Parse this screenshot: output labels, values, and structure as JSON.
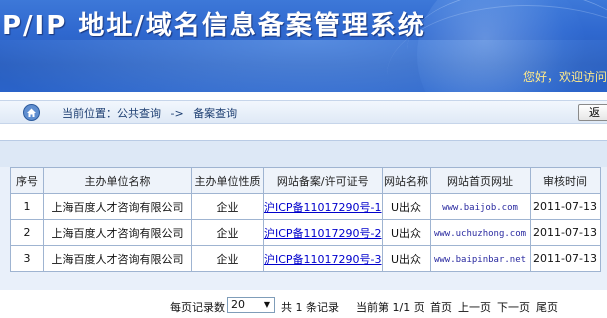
{
  "banner": {
    "title": "P/IP 地址/域名信息备案管理系统",
    "greeting": "您好，欢迎访问"
  },
  "breadcrumb": {
    "prefix": "当前位置：公共查询",
    "separator": "->",
    "current": "备案查询",
    "button_label": "返"
  },
  "table": {
    "headers": [
      "序号",
      "主办单位名称",
      "主办单位性质",
      "网站备案/许可证号",
      "网站名称",
      "网站首页网址",
      "审核时间"
    ],
    "rows": [
      {
        "no": "1",
        "org": "上海百度人才咨询有限公司",
        "type": "企业",
        "permit": "沪ICP备11017290号-1",
        "site": "U出众",
        "url": "www.baijob.com",
        "date": "2011-07-13"
      },
      {
        "no": "2",
        "org": "上海百度人才咨询有限公司",
        "type": "企业",
        "permit": "沪ICP备11017290号-2",
        "site": "U出众",
        "url": "www.uchuzhong.com",
        "date": "2011-07-13"
      },
      {
        "no": "3",
        "org": "上海百度人才咨询有限公司",
        "type": "企业",
        "permit": "沪ICP备11017290号-3",
        "site": "U出众",
        "url": "www.baipinbar.net",
        "date": "2011-07-13"
      }
    ]
  },
  "pager": {
    "per_page_label": "每页记录数",
    "per_page_value": "20",
    "total": "共 1 条记录",
    "current": "当前第 1/1 页",
    "first": "首页",
    "prev": "上一页",
    "next": "下一页",
    "last": "尾页"
  },
  "colors": {
    "banner_blue": "#2f68cf",
    "greeting_yellow": "#ffea8a",
    "link_blue": "#0000cc",
    "grid_border": "#9fb4d1"
  }
}
